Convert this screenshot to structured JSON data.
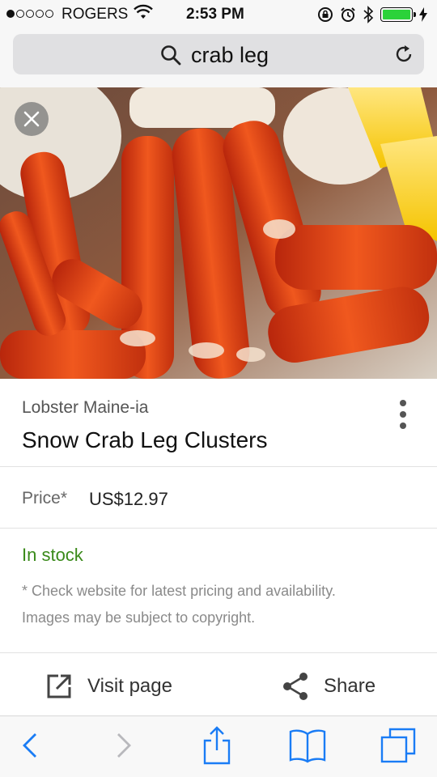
{
  "status_bar": {
    "carrier": "ROGERS",
    "time": "2:53 PM",
    "signal_bars_filled": 1,
    "signal_bars_total": 5,
    "battery_level": 1.0,
    "icons": [
      "wifi-icon",
      "lock-rotation-icon",
      "alarm-icon",
      "bluetooth-icon",
      "battery-icon",
      "charging-icon"
    ]
  },
  "url_bar": {
    "query": "crab leg",
    "icons": [
      "search-icon",
      "reload-icon"
    ]
  },
  "image": {
    "subject": "snow crab legs with lemon wedges",
    "close_icon": "close-icon"
  },
  "product": {
    "seller": "Lobster Maine-ia",
    "title": "Snow Crab Leg Clusters",
    "price_label": "Price*",
    "price_value": "US$12.97",
    "stock_status": "In stock",
    "disclaimer_line1": "* Check website for latest pricing and availability.",
    "disclaimer_line2": "Images may be subject to copyright."
  },
  "actions": {
    "visit_label": "Visit page",
    "share_label": "Share"
  },
  "toolbar": {
    "icons": [
      "back-icon",
      "forward-icon",
      "share-icon",
      "bookmarks-icon",
      "tabs-icon"
    ]
  },
  "colors": {
    "stock_green": "#3a8a1a",
    "ios_blue": "#1a7cf5",
    "battery_green": "#2bd23a"
  }
}
